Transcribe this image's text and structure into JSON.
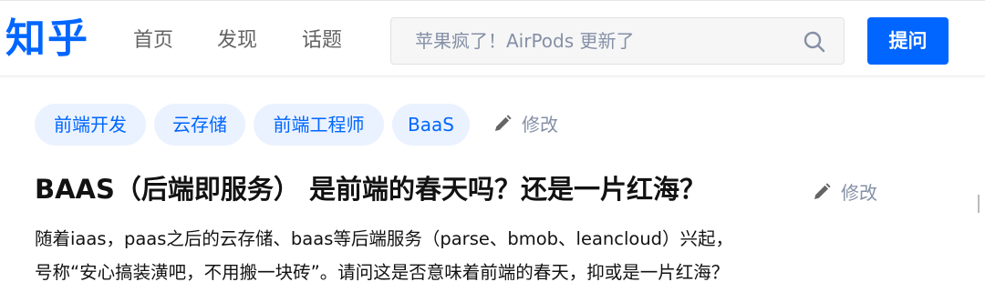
{
  "header": {
    "logo": "知乎",
    "nav": [
      "首页",
      "发现",
      "话题"
    ],
    "search_placeholder": "苹果疯了！AirPods 更新了",
    "ask_label": "提问"
  },
  "topics": {
    "tags": [
      "前端开发",
      "云存储",
      "前端工程师",
      "BaaS"
    ],
    "edit_label": "修改"
  },
  "question": {
    "title": "BAAS（后端即服务） 是前端的春天吗？还是一片红海？",
    "edit_label": "修改",
    "detail_lines": [
      "随着iaas，paas之后的云存储、baas等后端服务（parse、bmob、leancloud）兴起，",
      "号称“安心搞装潢吧，不用搬一块砖”。请问这是否意味着前端的春天，抑或是一片红海？"
    ]
  },
  "colors": {
    "brand": "#0066ff",
    "tag_bg": "#eaf2ff",
    "muted": "#8590a6"
  },
  "icons": [
    "search-icon",
    "pencil-icon"
  ]
}
